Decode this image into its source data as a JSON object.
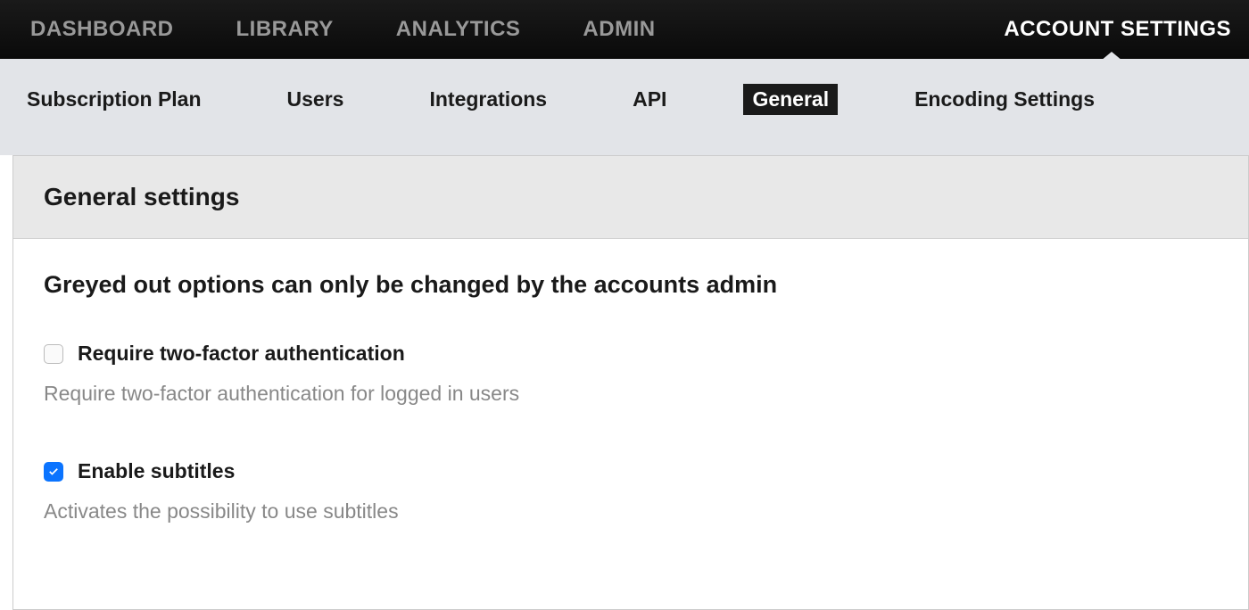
{
  "topNav": {
    "items": [
      {
        "label": "DASHBOARD",
        "active": false
      },
      {
        "label": "LIBRARY",
        "active": false
      },
      {
        "label": "ANALYTICS",
        "active": false
      },
      {
        "label": "ADMIN",
        "active": false
      },
      {
        "label": "ACCOUNT SETTINGS",
        "active": true
      }
    ]
  },
  "subNav": {
    "items": [
      {
        "label": "Subscription Plan",
        "active": false
      },
      {
        "label": "Users",
        "active": false
      },
      {
        "label": "Integrations",
        "active": false
      },
      {
        "label": "API",
        "active": false
      },
      {
        "label": "General",
        "active": true
      },
      {
        "label": "Encoding Settings",
        "active": false
      }
    ]
  },
  "panel": {
    "title": "General settings",
    "heading": "Greyed out options can only be changed by the accounts admin",
    "settings": [
      {
        "label": "Require two-factor authentication",
        "description": "Require two-factor authentication for logged in users",
        "checked": false
      },
      {
        "label": "Enable subtitles",
        "description": "Activates the possibility to use subtitles",
        "checked": true
      }
    ]
  }
}
